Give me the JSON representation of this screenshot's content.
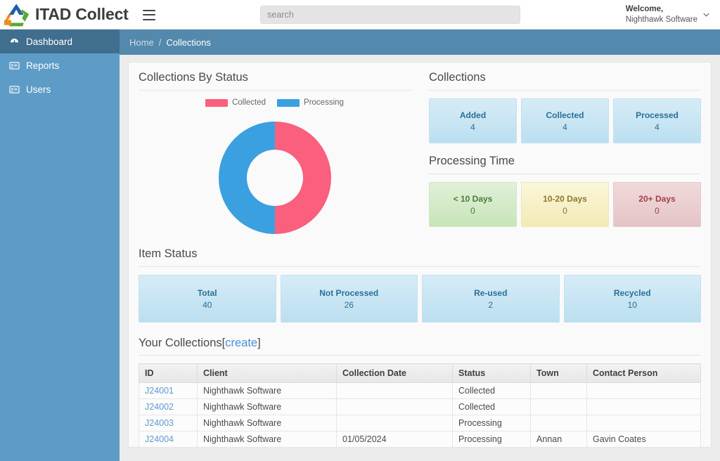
{
  "app": {
    "brand_name": "ITAD Collect",
    "logo_icon": "recycle-triangle-logo",
    "menu_icon": "hamburger-menu-icon"
  },
  "search": {
    "placeholder": "search",
    "value": "",
    "icon": "search-input"
  },
  "user": {
    "welcome_label": "Welcome,",
    "name": "Nighthawk Software",
    "chevron_icon": "chevron-down-icon"
  },
  "sidebar": {
    "items": [
      {
        "label": "Dashboard",
        "icon": "dashboard-gauge-icon",
        "active": true
      },
      {
        "label": "Reports",
        "icon": "report-list-icon",
        "active": false
      },
      {
        "label": "Users",
        "icon": "users-list-icon",
        "active": false
      }
    ]
  },
  "breadcrumb": {
    "home": "Home",
    "separator": "/",
    "current": "Collections"
  },
  "sections": {
    "collections_by_status": {
      "title": "Collections By Status"
    },
    "collections": {
      "title": "Collections"
    },
    "processing_time": {
      "title": "Processing Time"
    },
    "item_status": {
      "title": "Item Status"
    }
  },
  "chart_data": {
    "type": "pie",
    "title": "Collections By Status",
    "variant": "donut",
    "labels": [
      "Collected",
      "Processing"
    ],
    "values": [
      4,
      4
    ],
    "percentages": [
      50,
      50
    ],
    "colors": [
      "#fa5f7d",
      "#3aa0e0"
    ],
    "legend_position": "top",
    "grid": false
  },
  "collections_cards": [
    {
      "label": "Added",
      "value": "4",
      "tone": "blue"
    },
    {
      "label": "Collected",
      "value": "4",
      "tone": "blue"
    },
    {
      "label": "Processed",
      "value": "4",
      "tone": "blue"
    }
  ],
  "processing_time_cards": [
    {
      "label": "< 10 Days",
      "value": "0",
      "tone": "green"
    },
    {
      "label": "10-20 Days",
      "value": "0",
      "tone": "yellow"
    },
    {
      "label": "20+ Days",
      "value": "0",
      "tone": "red"
    }
  ],
  "item_status_cards": [
    {
      "label": "Total",
      "value": "40",
      "tone": "blue"
    },
    {
      "label": "Not Processed",
      "value": "26",
      "tone": "blue"
    },
    {
      "label": "Re-used",
      "value": "2",
      "tone": "blue"
    },
    {
      "label": "Recycled",
      "value": "10",
      "tone": "blue"
    }
  ],
  "your_collections": {
    "title": "Your Collections",
    "bracket_open": "[",
    "create_link": "create",
    "bracket_close": "]",
    "columns": [
      "ID",
      "Client",
      "Collection Date",
      "Status",
      "Town",
      "Contact Person"
    ],
    "rows": [
      {
        "id": "J24001",
        "client": "Nighthawk Software",
        "date": "",
        "status": "Collected",
        "town": "",
        "contact": ""
      },
      {
        "id": "J24002",
        "client": "Nighthawk Software",
        "date": "",
        "status": "Collected",
        "town": "",
        "contact": ""
      },
      {
        "id": "J24003",
        "client": "Nighthawk Software",
        "date": "",
        "status": "Processing",
        "town": "",
        "contact": ""
      },
      {
        "id": "J24004",
        "client": "Nighthawk Software",
        "date": "01/05/2024",
        "status": "Processing",
        "town": "Annan",
        "contact": "Gavin Coates"
      }
    ]
  },
  "colors": {
    "sidebar": "#5d9cc6",
    "sidebar_active": "#3f6e8e",
    "breadcrumb_bar": "#5389ad",
    "link": "#5b9bd5",
    "collected": "#fa5f7d",
    "processing": "#3aa0e0"
  }
}
